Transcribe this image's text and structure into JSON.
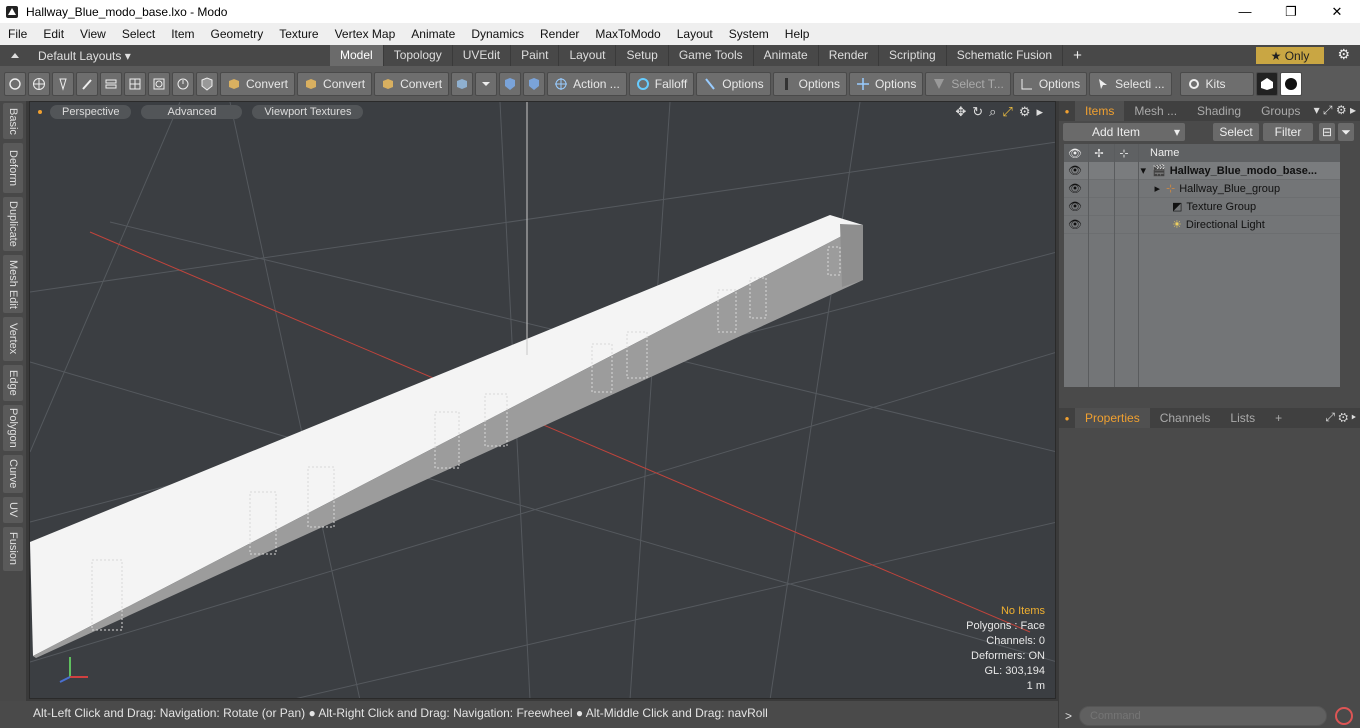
{
  "window": {
    "title": "Hallway_Blue_modo_base.lxo - Modo",
    "minimize": "—",
    "maximize": "❐",
    "close": "✕"
  },
  "menu": [
    "File",
    "Edit",
    "View",
    "Select",
    "Item",
    "Geometry",
    "Texture",
    "Vertex Map",
    "Animate",
    "Dynamics",
    "Render",
    "MaxToModo",
    "Layout",
    "System",
    "Help"
  ],
  "layouts": {
    "dropdown": "Default Layouts ▾",
    "tabs": [
      "Model",
      "Topology",
      "UVEdit",
      "Paint",
      "Layout",
      "Setup",
      "Game Tools",
      "Animate",
      "Render",
      "Scripting",
      "Schematic Fusion"
    ],
    "active": "Model",
    "plus": "+",
    "only": "★  Only",
    "gear": "⚙"
  },
  "toolbar": {
    "convert1": "Convert",
    "convert2": "Convert",
    "convert3": "Convert",
    "action": "Action ...",
    "falloff": "Falloff",
    "options1": "Options",
    "options2": "Options",
    "options3": "Options",
    "select_t": "Select T...",
    "options4": "Options",
    "selecti": "Selecti ...",
    "kits": "Kits"
  },
  "lefttabs": [
    "Basic",
    "Deform",
    "Duplicate",
    "Mesh Edit",
    "Vertex",
    "Edge",
    "Polygon",
    "Curve",
    "UV",
    "Fusion"
  ],
  "viewport": {
    "perspective": "Perspective",
    "advanced": "Advanced",
    "textures": "Viewport Textures",
    "info": {
      "no_items": "No Items",
      "polygons": "Polygons : Face",
      "channels": "Channels: 0",
      "deformers": "Deformers: ON",
      "gl": "GL: 303,194",
      "scale": "1 m"
    }
  },
  "status": "Alt-Left Click and Drag: Navigation: Rotate (or Pan) ● Alt-Right Click and Drag: Navigation: Freewheel ● Alt-Middle Click and Drag: navRoll",
  "items_panel": {
    "tabs": [
      "Items",
      "Mesh ...",
      "Shading",
      "Groups"
    ],
    "add_item": "Add Item",
    "dropdown": "▾",
    "select": "Select",
    "filter": "Filter",
    "name_col": "Name",
    "rows": [
      {
        "label": "Hallway_Blue_modo_base..."
      },
      {
        "label": "Hallway_Blue_group"
      },
      {
        "label": "Texture Group"
      },
      {
        "label": "Directional Light"
      }
    ]
  },
  "props_panel": {
    "tabs": [
      "Properties",
      "Channels",
      "Lists"
    ],
    "plus": "+"
  },
  "command": {
    "placeholder": "Command",
    "prompt": ">"
  }
}
